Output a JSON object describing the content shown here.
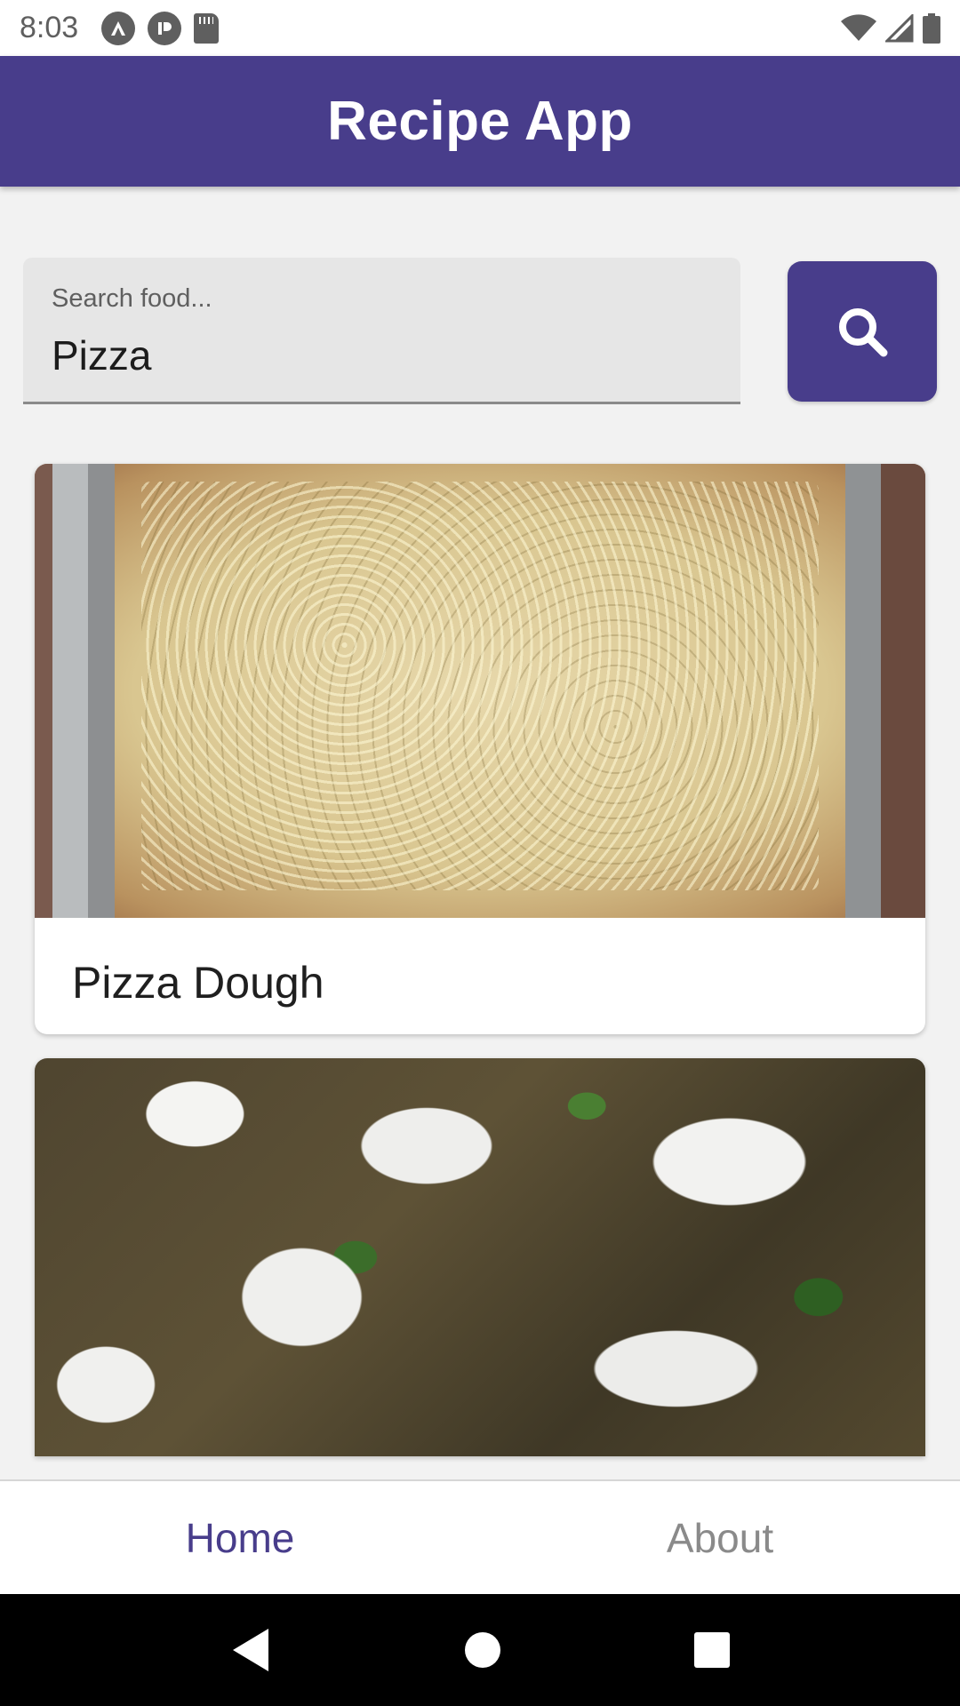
{
  "status_bar": {
    "time": "8:03",
    "left_icons": [
      "android-a-icon",
      "p-icon",
      "sd-card-icon"
    ],
    "right_icons": [
      "wifi-icon",
      "cellular-signal-icon",
      "battery-icon"
    ]
  },
  "app_bar": {
    "title": "Recipe App",
    "color": "#483d8b"
  },
  "search": {
    "label": "Search food...",
    "value": "Pizza",
    "button_icon": "search-icon"
  },
  "results": [
    {
      "title": "Pizza Dough",
      "image": "pizza-dough-photo"
    },
    {
      "title": "",
      "image": "burrata-pizza-photo"
    }
  ],
  "bottom_nav": {
    "items": [
      {
        "label": "Home",
        "active": true
      },
      {
        "label": "About",
        "active": false
      }
    ],
    "active_color": "#483d8b",
    "inactive_color": "#8a8a8a"
  },
  "system_nav": [
    "back-icon",
    "home-icon",
    "recents-icon"
  ]
}
